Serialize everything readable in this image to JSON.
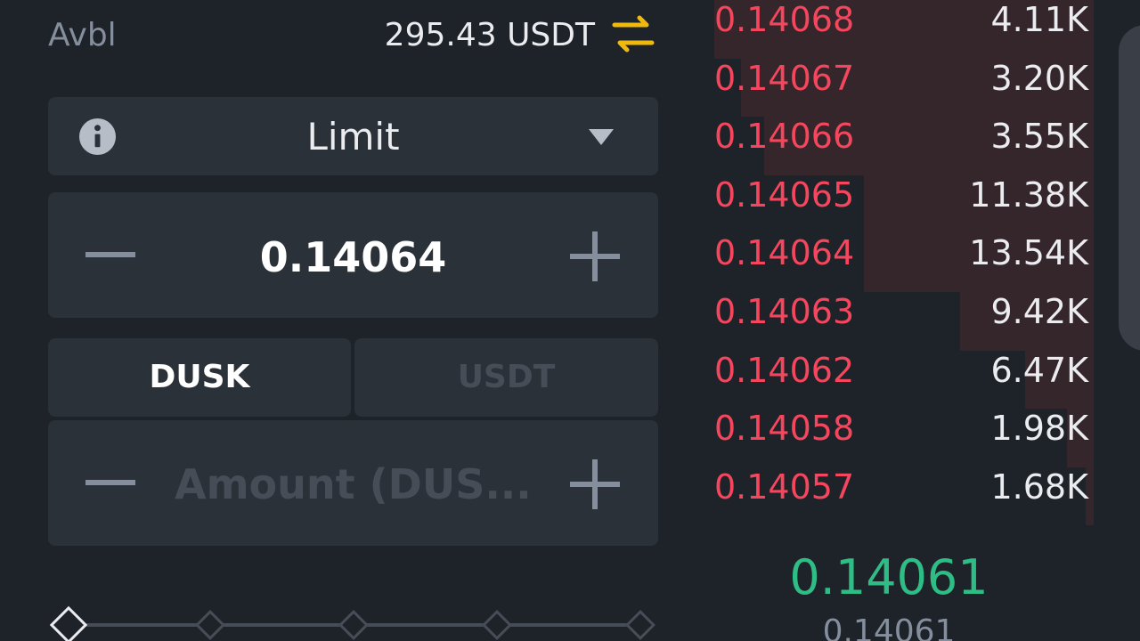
{
  "balance": {
    "label": "Avbl",
    "value": "295.43 USDT",
    "transfer_icon": "swap-arrows-icon"
  },
  "order_form": {
    "order_type": "Limit",
    "price_value": "0.14064",
    "unit_tabs": [
      "DUSK",
      "USDT"
    ],
    "selected_unit": "DUSK",
    "amount_placeholder": "Amount (DUS..."
  },
  "order_book": {
    "asks": [
      {
        "price": "0.14068",
        "qty": "4.11K",
        "depth": 0.99
      },
      {
        "price": "0.14067",
        "qty": "3.20K",
        "depth": 0.92
      },
      {
        "price": "0.14066",
        "qty": "3.55K",
        "depth": 0.86
      },
      {
        "price": "0.14065",
        "qty": "11.38K",
        "depth": 0.6
      },
      {
        "price": "0.14064",
        "qty": "13.54K",
        "depth": 0.6
      },
      {
        "price": "0.14063",
        "qty": "9.42K",
        "depth": 0.35
      },
      {
        "price": "0.14062",
        "qty": "6.47K",
        "depth": 0.18
      },
      {
        "price": "0.14058",
        "qty": "1.98K",
        "depth": 0.07
      },
      {
        "price": "0.14057",
        "qty": "1.68K",
        "depth": 0.02
      }
    ],
    "last_price": "0.14061",
    "mark_price": "0.14061"
  },
  "colors": {
    "ask": "#f6465d",
    "bid": "#2ebd85",
    "accent": "#f0b90b",
    "background": "#1e2329",
    "panel": "#2b3139"
  }
}
